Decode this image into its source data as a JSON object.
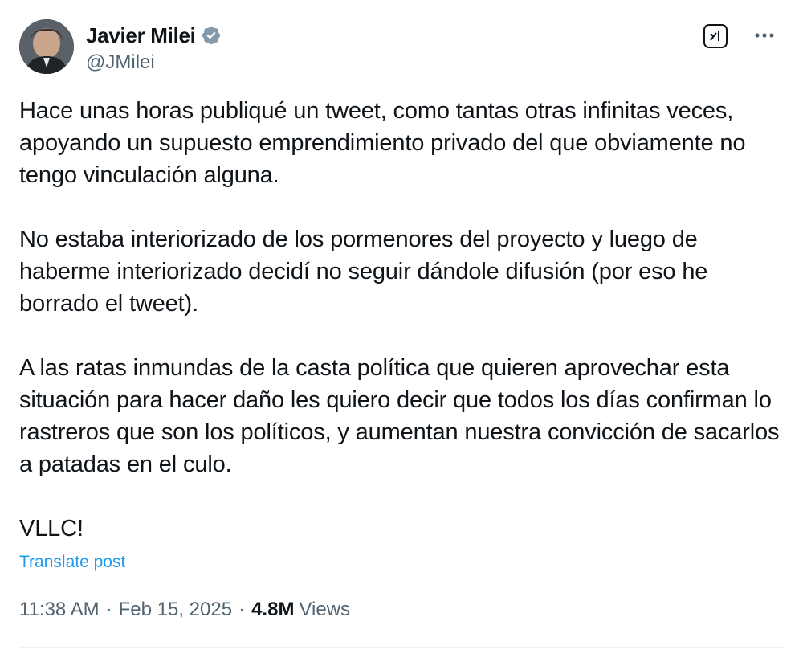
{
  "author": {
    "name": "Javier Milei",
    "handle": "@JMilei",
    "verified_color": "#829aab"
  },
  "actions": {
    "grok_icon": "grok-icon",
    "more_icon": "more-icon"
  },
  "post": {
    "paragraphs": [
      "Hace unas horas publiqué un tweet, como tantas otras infinitas veces, apoyando un supuesto emprendimiento privado del que obviamente no tengo vinculación alguna.",
      "No estaba interiorizado de los pormenores del proyecto y luego de haberme interiorizado decidí no seguir dándole difusión (por eso he borrado el tweet).",
      "A las ratas inmundas de la casta política que quieren aprovechar esta situación para hacer daño les quiero decir que todos los días confirman lo rastreros que son los políticos, y aumentan nuestra convicción de sacarlos a patadas en el culo.",
      "VLLC!"
    ],
    "translate_label": "Translate post",
    "time": "11:38 AM",
    "separator": "·",
    "date": "Feb 15, 2025",
    "views_count": "4.8M",
    "views_label": "Views"
  },
  "colors": {
    "text": "#0f1419",
    "secondary": "#536471",
    "link": "#1d9bf0"
  }
}
